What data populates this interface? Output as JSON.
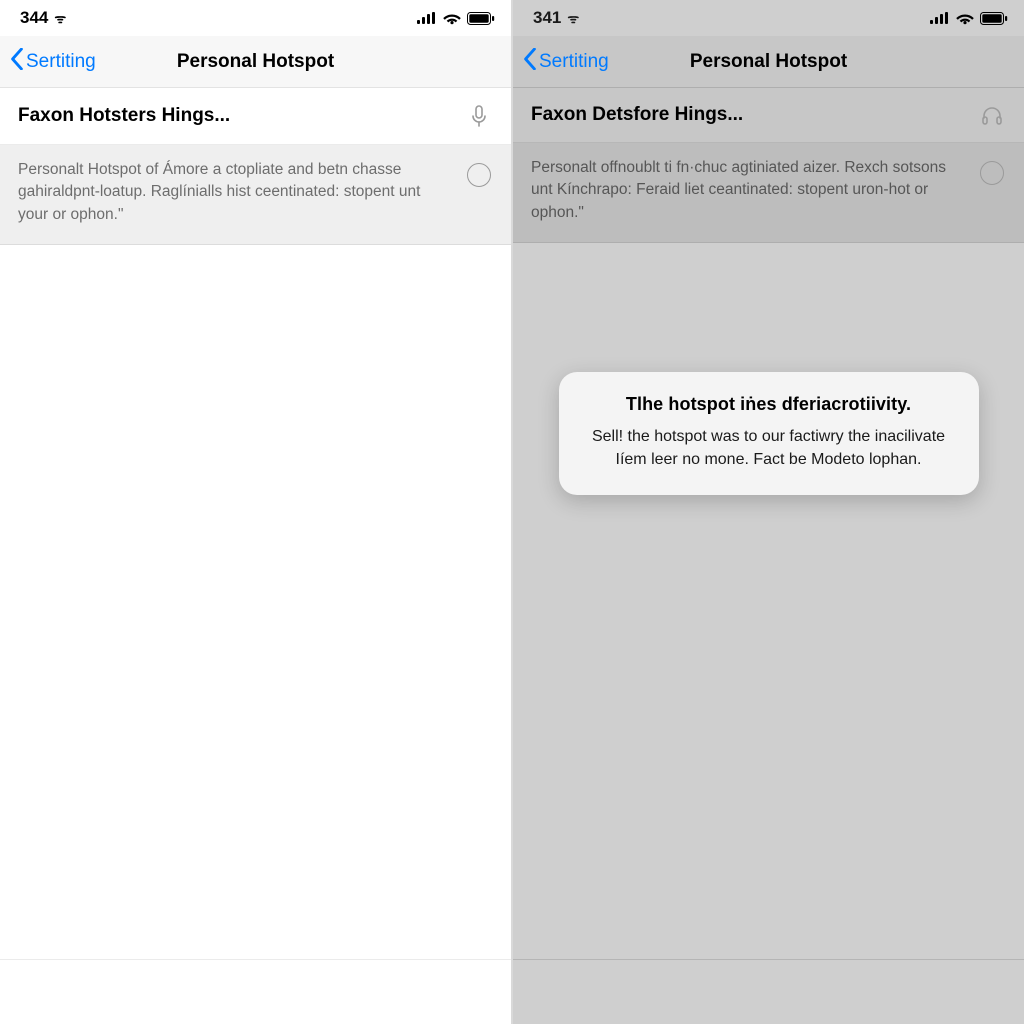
{
  "left": {
    "status": {
      "time": "344",
      "wifi_glyph": "ᯤ"
    },
    "nav": {
      "back": "Sertiting",
      "title": "Personal Hotspot"
    },
    "row1": "Faxon Hotsters Hings...",
    "desc": "Personalt Hotspot of Ámore a ctopliate and betn chasse gahiraldpnt-loatup. Raglínialls hist ceentinated: stopent unt your or ophon.\""
  },
  "right": {
    "status": {
      "time": "341",
      "wifi_glyph": "ᯤ"
    },
    "nav": {
      "back": "Sertiting",
      "title": "Personal Hotspot"
    },
    "row1": "Faxon Detsfore Hings...",
    "desc": "Personalt offnoublt ti fn·chuc agtiniated aizer. Rexch sotsons unt Kínchrapo: Feraid liet ceantinated: stopent uron-hot or ophon.\"",
    "alert": {
      "title": "Tlhe hotspot iṅes dferiacrotiivity.",
      "body": "Sell! the hotspot was to our factiwry the inacilivate Iíem leer no mone. Fact be Modeto lophan."
    }
  }
}
